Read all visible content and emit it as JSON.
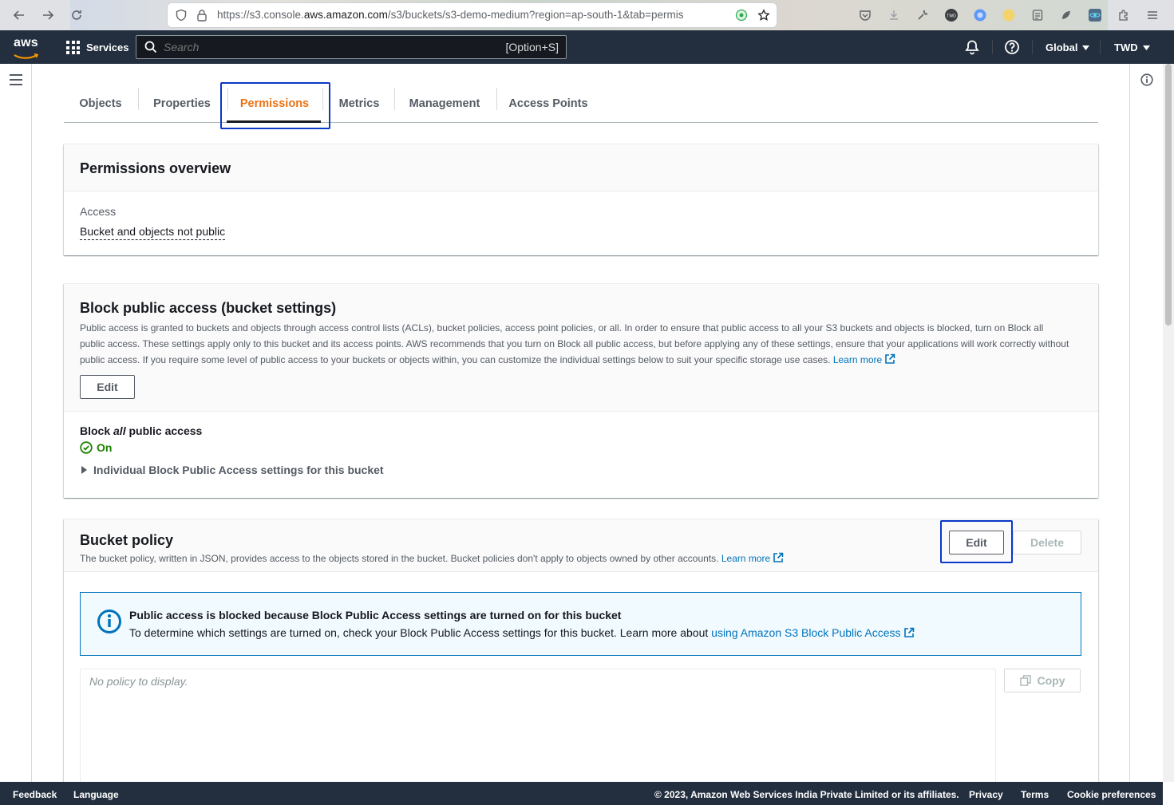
{
  "browser": {
    "url_prefix": "https://s3.console.",
    "url_host": "aws.amazon.com",
    "url_rest": "/s3/buckets/s3-demo-medium?region=ap-south-1&tab=permis"
  },
  "topnav": {
    "logo": "aws",
    "services_label": "Services",
    "search_placeholder": "Search",
    "search_shortcut": "[Option+S]",
    "region_label": "Global",
    "account_label": "TWD"
  },
  "tabs": [
    {
      "label": "Objects"
    },
    {
      "label": "Properties"
    },
    {
      "label": "Permissions"
    },
    {
      "label": "Metrics"
    },
    {
      "label": "Management"
    },
    {
      "label": "Access Points"
    }
  ],
  "overview": {
    "title": "Permissions overview",
    "access_label": "Access",
    "access_value": "Bucket and objects not public"
  },
  "block_public": {
    "title": "Block public access (bucket settings)",
    "description": "Public access is granted to buckets and objects through access control lists (ACLs), bucket policies, access point policies, or all. In order to ensure that public access to all your S3 buckets and objects is blocked, turn on Block all public access. These settings apply only to this bucket and its access points. AWS recommends that you turn on Block all public access, but before applying any of these settings, ensure that your applications will work correctly without public access. If you require some level of public access to your buckets or objects within, you can customize the individual settings below to suit your specific storage use cases.",
    "learn_more": "Learn more",
    "edit_label": "Edit",
    "setting_prefix": "Block ",
    "setting_emph": "all",
    "setting_suffix": " public access",
    "status": "On",
    "expander": "Individual Block Public Access settings for this bucket"
  },
  "bucket_policy": {
    "title": "Bucket policy",
    "description": "The bucket policy, written in JSON, provides access to the objects stored in the bucket. Bucket policies don't apply to objects owned by other accounts.",
    "learn_more": "Learn more",
    "edit_label": "Edit",
    "delete_label": "Delete",
    "alert_title": "Public access is blocked because Block Public Access settings are turned on for this bucket",
    "alert_body": "To determine which settings are turned on, check your Block Public Access settings for this bucket. Learn more about ",
    "alert_link": "using Amazon S3 Block Public Access",
    "placeholder": "No policy to display.",
    "copy_label": "Copy"
  },
  "footer": {
    "feedback": "Feedback",
    "language": "Language",
    "copyright": "© 2023, Amazon Web Services India Private Limited or its affiliates.",
    "privacy": "Privacy",
    "terms": "Terms",
    "cookies": "Cookie preferences"
  },
  "colors": {
    "nav_bg": "#232f3e",
    "active_tab": "#ec7211",
    "link": "#0073bb",
    "success": "#1d8102",
    "focus": "#0b38c7"
  }
}
